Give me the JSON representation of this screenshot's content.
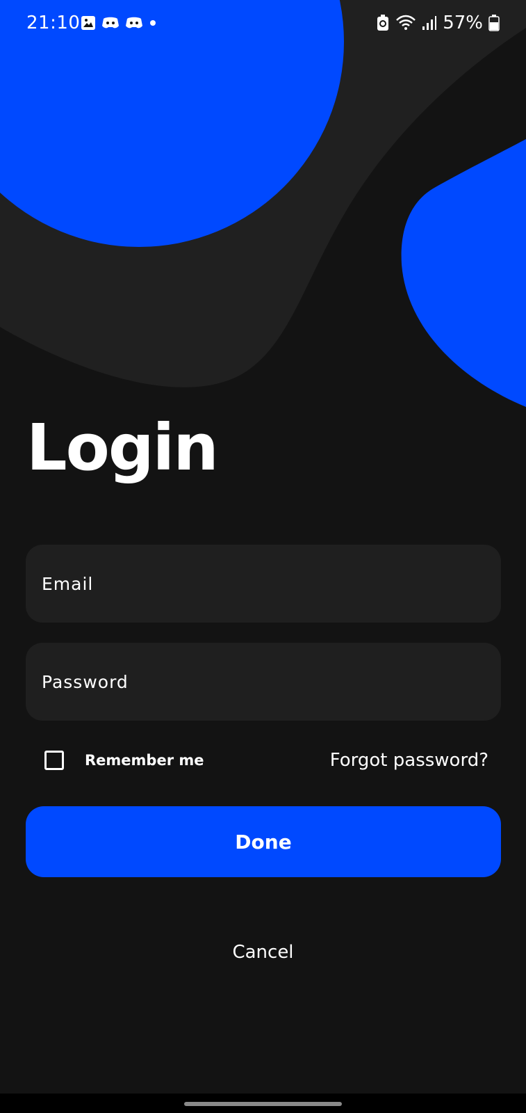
{
  "status_bar": {
    "time": "21:10",
    "battery": "57%",
    "left_icons": [
      "gallery-icon",
      "discord-icon",
      "discord-icon",
      "dot-icon"
    ],
    "right_icons": [
      "battery-saver-icon",
      "wifi-icon",
      "signal-icon",
      "battery-icon"
    ]
  },
  "login": {
    "title": "Login",
    "email_placeholder": "Email",
    "password_placeholder": "Password",
    "remember_label": "Remember me",
    "remember_checked": false,
    "forgot_label": "Forgot password?",
    "done_label": "Done",
    "cancel_label": "Cancel"
  },
  "colors": {
    "background": "#131313",
    "accent": "#0049ff",
    "field_background": "#1f1f1f",
    "blob_secondary": "#202020"
  }
}
